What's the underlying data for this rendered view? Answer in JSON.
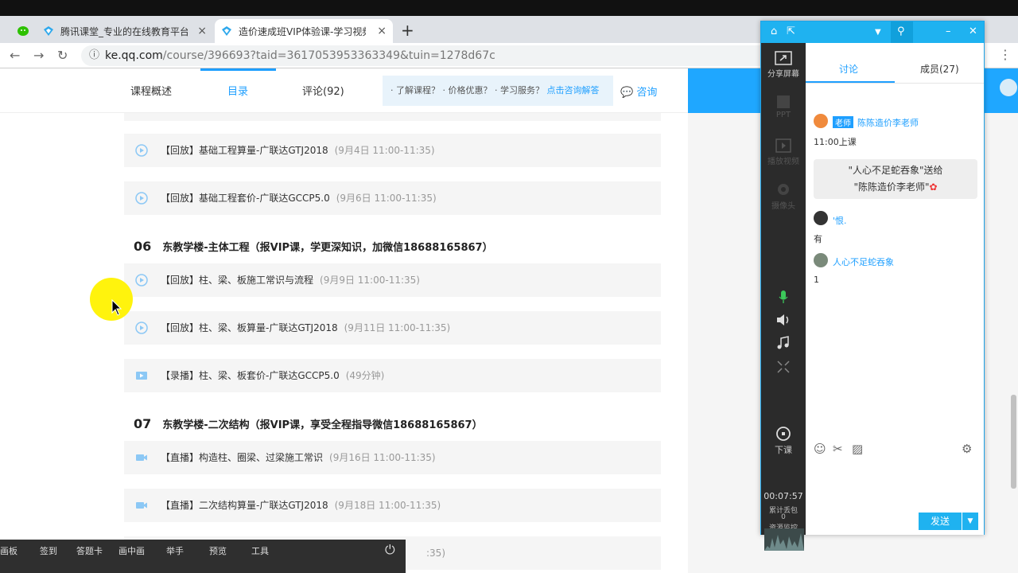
{
  "browser": {
    "tabs": [
      {
        "title": "腾讯课堂_专业的在线教育平台(k"
      },
      {
        "title": "造价速成班VIP体验课-学习视频"
      }
    ],
    "new_tab": "+",
    "close": "×",
    "url_host": "ke.qq.com",
    "url_path": "/course/396693?taid=3617053953363349&tuin=1278d67c"
  },
  "subnav": {
    "items": [
      "课程概述",
      "目录",
      "评论(92)"
    ],
    "promo_text": "· 了解课程？ · 价格优惠？ · 学习服务？",
    "promo_link": "点击咨询解答",
    "consult": "咨询"
  },
  "catalog": {
    "top_lessons": [
      {
        "title": "【回放】基础工程算量-广联达GTJ2018",
        "time": "(9月4日 11:00-11:35)"
      },
      {
        "title": "【回放】基础工程套价-广联达GCCP5.0",
        "time": "(9月6日 11:00-11:35)"
      }
    ],
    "sections": [
      {
        "num": "06",
        "title": "东教学楼-主体工程（报VIP课，学更深知识，加微信18688165867）",
        "lessons": [
          {
            "title": "【回放】柱、梁、板施工常识与流程",
            "time": "(9月9日 11:00-11:35)"
          },
          {
            "title": "【回放】柱、梁、板算量-广联达GTJ2018",
            "time": "(9月11日 11:00-11:35)"
          },
          {
            "title": "【录播】柱、梁、板套价-广联达GCCP5.0",
            "time": "(49分钟)"
          }
        ]
      },
      {
        "num": "07",
        "title": "东教学楼-二次结构（报VIP课，享受全程指导微信18688165867）",
        "lessons": [
          {
            "title": "【直播】构造柱、圈梁、过梁施工常识",
            "time": "(9月16日 11:00-11:35)"
          },
          {
            "title": "【直播】二次结构算量-广联达GTJ2018",
            "time": "(9月18日 11:00-11:35)"
          }
        ]
      }
    ],
    "partial_time": ":35)"
  },
  "bottom_toolbar": {
    "items": [
      "画板",
      "签到",
      "答题卡",
      "画中画",
      "举手",
      "预览",
      "工具"
    ]
  },
  "panel": {
    "sidebar": {
      "share_screen": "分享屏幕",
      "ppt": "PPT",
      "play_video": "播放视频",
      "camera": "摄像头",
      "end_class": "下课",
      "timer": "00:07:57",
      "packet_loss_label": "累计丢包",
      "packet_loss_value": "0",
      "resource_monitor": "资源监控"
    },
    "tabs": [
      "讨论",
      "成员(27)"
    ],
    "messages": [
      {
        "badge": "老师",
        "name": "陈陈造价李老师",
        "text": "11:00上课"
      },
      {
        "name": "'恨.",
        "text": "有"
      },
      {
        "name": "人心不足蛇吞象",
        "text": "1"
      }
    ],
    "gift_line1": "\"人心不足蛇吞象\"送给",
    "gift_line2": "\"陈陈造价李老师\"",
    "send": "发送"
  },
  "colors": {
    "accent": "#1e9fff",
    "panel_header": "#1fb2f0",
    "sidebar_dark": "#2b2b2b",
    "highlight": "#fff200"
  }
}
